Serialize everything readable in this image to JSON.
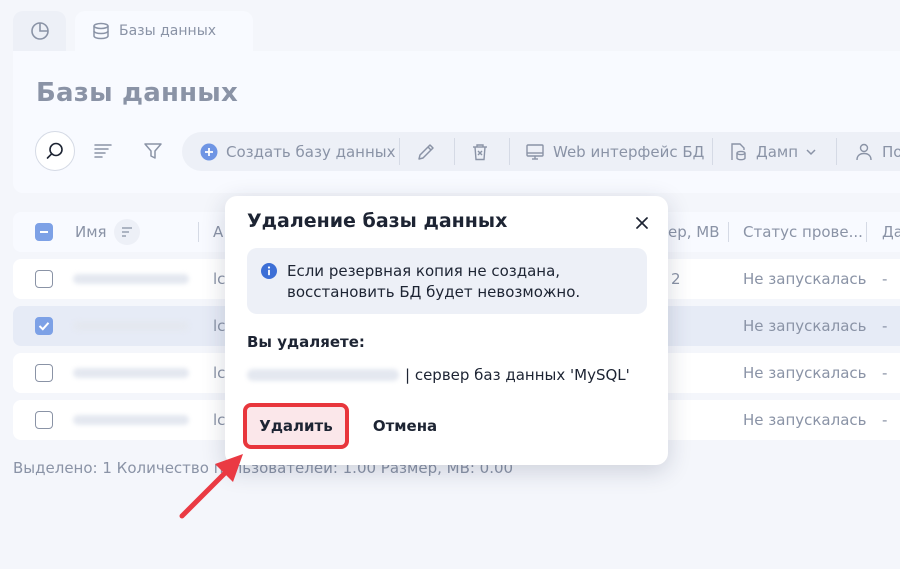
{
  "tabs": [
    {
      "label": ""
    },
    {
      "label": "Базы данных"
    }
  ],
  "page_title": "Базы данных",
  "toolbar": {
    "create_label": "Создать базу данных",
    "web_label": "Web интерфейс БД",
    "dump_label": "Дамп",
    "user_label": "По"
  },
  "table": {
    "headers": [
      "Имя",
      "А",
      "ер, MB",
      "Статус прове...",
      "Да"
    ],
    "rows": [
      {
        "col2": "lc",
        "size": "2",
        "status": "Не запускалась",
        "date": "-"
      },
      {
        "col2": "lc",
        "size": "",
        "status": "Не запускалась",
        "date": "-"
      },
      {
        "col2": "lc",
        "size": "",
        "status": "Не запускалась",
        "date": "-"
      },
      {
        "col2": "lc",
        "size": "",
        "status": "Не запускалась",
        "date": "-"
      }
    ]
  },
  "footer": "Выделено: 1  Количество пользователей: 1.00  Размер, MB: 0.00",
  "modal": {
    "title": "Удаление базы данных",
    "alert": "Если резервная копия не создана, восстановить БД будет невозможно.",
    "deleting_label": "Вы удаляете:",
    "server_text": "| сервер баз данных 'MySQL'",
    "delete_button": "Удалить",
    "cancel_button": "Отмена"
  },
  "colors": {
    "accent": "#7da1e6",
    "danger": "#e8363c"
  }
}
